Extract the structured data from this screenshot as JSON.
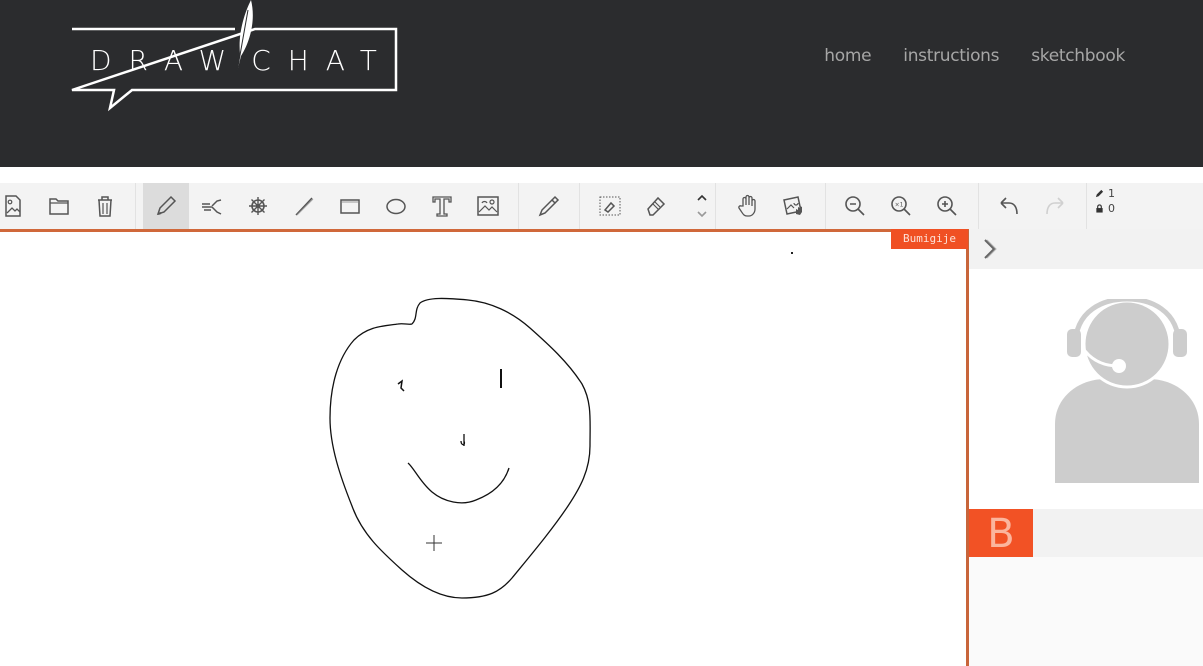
{
  "header": {
    "logo_text_left": "DRAW",
    "logo_text_right": "CHAT",
    "nav": [
      {
        "label": "home"
      },
      {
        "label": "instructions"
      },
      {
        "label": "sketchbook"
      }
    ]
  },
  "toolbar": {
    "groups": [
      [
        "open-image-icon",
        "open-folder-icon",
        "trash-icon"
      ],
      [
        "pencil-icon",
        "spray-brush-icon",
        "wheel-brush-icon",
        "line-icon",
        "rectangle-icon",
        "ellipse-icon",
        "text-icon",
        "insert-image-icon"
      ],
      [
        "eyedropper-icon"
      ],
      [
        "select-erase-icon",
        "eraser-icon",
        "layer-up-down-icon"
      ],
      [
        "hand-pan-icon",
        "photo-move-icon"
      ],
      [
        "zoom-out-icon",
        "zoom-reset-icon",
        "zoom-in-icon"
      ],
      [
        "undo-icon",
        "redo-icon"
      ]
    ],
    "active_tool": "pencil",
    "counters": {
      "draw_count": "1",
      "lock_count": "0"
    }
  },
  "canvas": {
    "user_tag": "Bumigije"
  },
  "panel": {
    "user_initial": "B"
  },
  "colors": {
    "accent": "#f05023",
    "header_bg": "#2b2c2e",
    "canvas_border": "#d0683a"
  }
}
